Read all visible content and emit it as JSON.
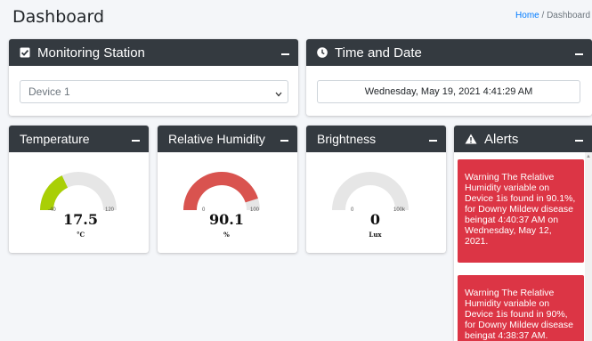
{
  "header": {
    "title": "Dashboard",
    "breadcrumb_home": "Home",
    "breadcrumb_sep": "/",
    "breadcrumb_current": "Dashboard"
  },
  "monitoring": {
    "title": "Monitoring Station",
    "selected_device": "Device 1"
  },
  "timedate": {
    "title": "Time and Date",
    "value": "Wednesday, May 19, 2021 4:41:29 AM"
  },
  "temperature": {
    "title": "Temperature",
    "value": "17.5",
    "unit": "°C",
    "min": "-40",
    "max": "120",
    "numeric": 17.5,
    "range": [
      -40,
      120
    ],
    "color": "#a9cf06"
  },
  "humidity": {
    "title": "Relative Humidity",
    "value": "90.1",
    "unit": "%",
    "min": "0",
    "max": "100",
    "numeric": 90.1,
    "range": [
      0,
      100
    ],
    "color": "#d9534f"
  },
  "brightness": {
    "title": "Brightness",
    "value": "0",
    "unit": "Lux",
    "min": "0",
    "max": "100k",
    "numeric": 0,
    "range": [
      0,
      100000
    ],
    "color": "#e6e6e6"
  },
  "alerts": {
    "title": "Alerts",
    "items": [
      "Warning The Relative Humidity variable on Device 1is found in 90.1%, for Downy Mildew disease beingat 4:40:37 AM on Wednesday, May 12, 2021.",
      "Warning The Relative Humidity variable on Device 1is found in 90%, for Downy Mildew disease beingat 4:38:37 AM."
    ],
    "color": "#dc3545"
  },
  "colors": {
    "header_bg": "#343a40",
    "page_bg": "#f4f6f9",
    "link": "#007bff"
  }
}
